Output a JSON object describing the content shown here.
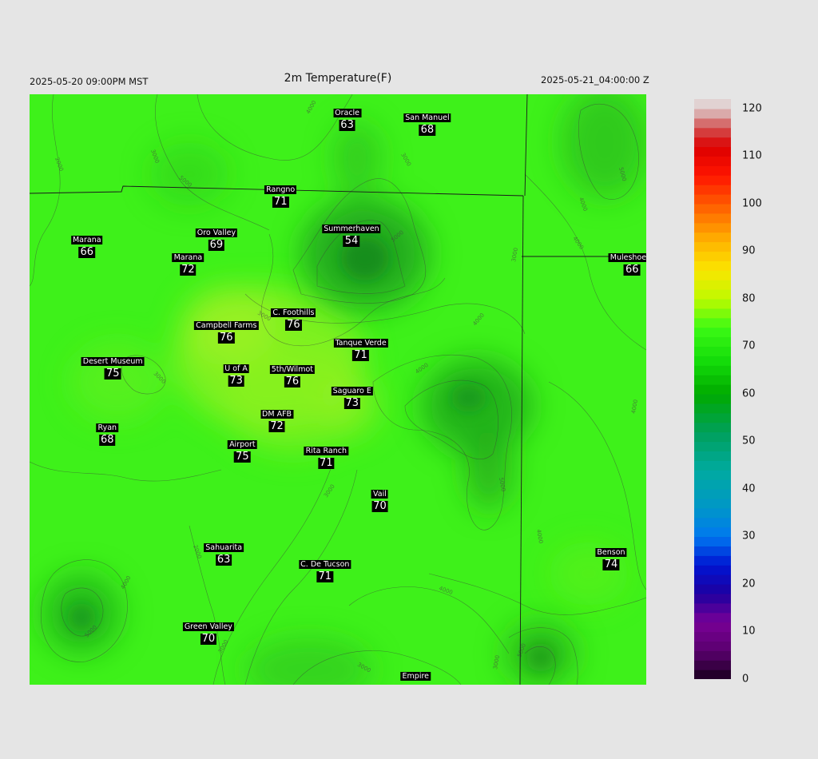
{
  "header": {
    "valid_local": "2025-05-20 09:00PM MST",
    "title": "2m Temperature(F)",
    "valid_utc": "2025-05-21_04:00:00 Z"
  },
  "stations": [
    {
      "name": "Oracle",
      "value": "63",
      "fx": 0.515,
      "fy": 0.033
    },
    {
      "name": "San Manuel",
      "value": "68",
      "fx": 0.645,
      "fy": 0.04
    },
    {
      "name": "Rangno",
      "value": "71",
      "fx": 0.407,
      "fy": 0.163
    },
    {
      "name": "Summerhaven",
      "value": "54",
      "fx": 0.522,
      "fy": 0.229
    },
    {
      "name": "Oro Valley",
      "value": "69",
      "fx": 0.303,
      "fy": 0.235
    },
    {
      "name": "Marana",
      "value": "66",
      "fx": 0.093,
      "fy": 0.247
    },
    {
      "name": "Marana",
      "value": "72",
      "fx": 0.257,
      "fy": 0.278
    },
    {
      "name": "Muleshoe R",
      "value": "66",
      "fx": 0.977,
      "fy": 0.277
    },
    {
      "name": "C. Foothills",
      "value": "76",
      "fx": 0.428,
      "fy": 0.371
    },
    {
      "name": "Campbell Farms",
      "value": "76",
      "fx": 0.319,
      "fy": 0.393
    },
    {
      "name": "Tanque Verde",
      "value": "71",
      "fx": 0.537,
      "fy": 0.422
    },
    {
      "name": "Desert Museum",
      "value": "75",
      "fx": 0.135,
      "fy": 0.453
    },
    {
      "name": "U of A",
      "value": "73",
      "fx": 0.335,
      "fy": 0.465
    },
    {
      "name": "5th/Wilmot",
      "value": "76",
      "fx": 0.426,
      "fy": 0.467
    },
    {
      "name": "Saguaro E",
      "value": "73",
      "fx": 0.523,
      "fy": 0.504
    },
    {
      "name": "DM AFB",
      "value": "72",
      "fx": 0.401,
      "fy": 0.542
    },
    {
      "name": "Ryan",
      "value": "68",
      "fx": 0.126,
      "fy": 0.566
    },
    {
      "name": "Airport",
      "value": "75",
      "fx": 0.345,
      "fy": 0.594
    },
    {
      "name": "Rita Ranch",
      "value": "71",
      "fx": 0.481,
      "fy": 0.605
    },
    {
      "name": "Vail",
      "value": "70",
      "fx": 0.568,
      "fy": 0.678
    },
    {
      "name": "Sahuarita",
      "value": "63",
      "fx": 0.315,
      "fy": 0.768
    },
    {
      "name": "C. De Tucson",
      "value": "71",
      "fx": 0.479,
      "fy": 0.797
    },
    {
      "name": "Benson",
      "value": "74",
      "fx": 0.943,
      "fy": 0.777
    },
    {
      "name": "Green Valley",
      "value": "70",
      "fx": 0.29,
      "fy": 0.902
    },
    {
      "name": "Empire",
      "value": "",
      "fx": 0.626,
      "fy": 0.987
    }
  ],
  "contour_labels": [
    "2000",
    "3000",
    "4000",
    "5000",
    "6000",
    "7000",
    "8000"
  ],
  "colorbar": {
    "ticks": [
      "0",
      "10",
      "20",
      "30",
      "40",
      "50",
      "60",
      "70",
      "80",
      "90",
      "100",
      "110",
      "120"
    ],
    "min": 0,
    "max": 122
  },
  "colors": {
    "background": "#e5e5e5",
    "map_base": "#3ef11a",
    "label_bg": "#000000",
    "label_fg": "#ffffff"
  }
}
